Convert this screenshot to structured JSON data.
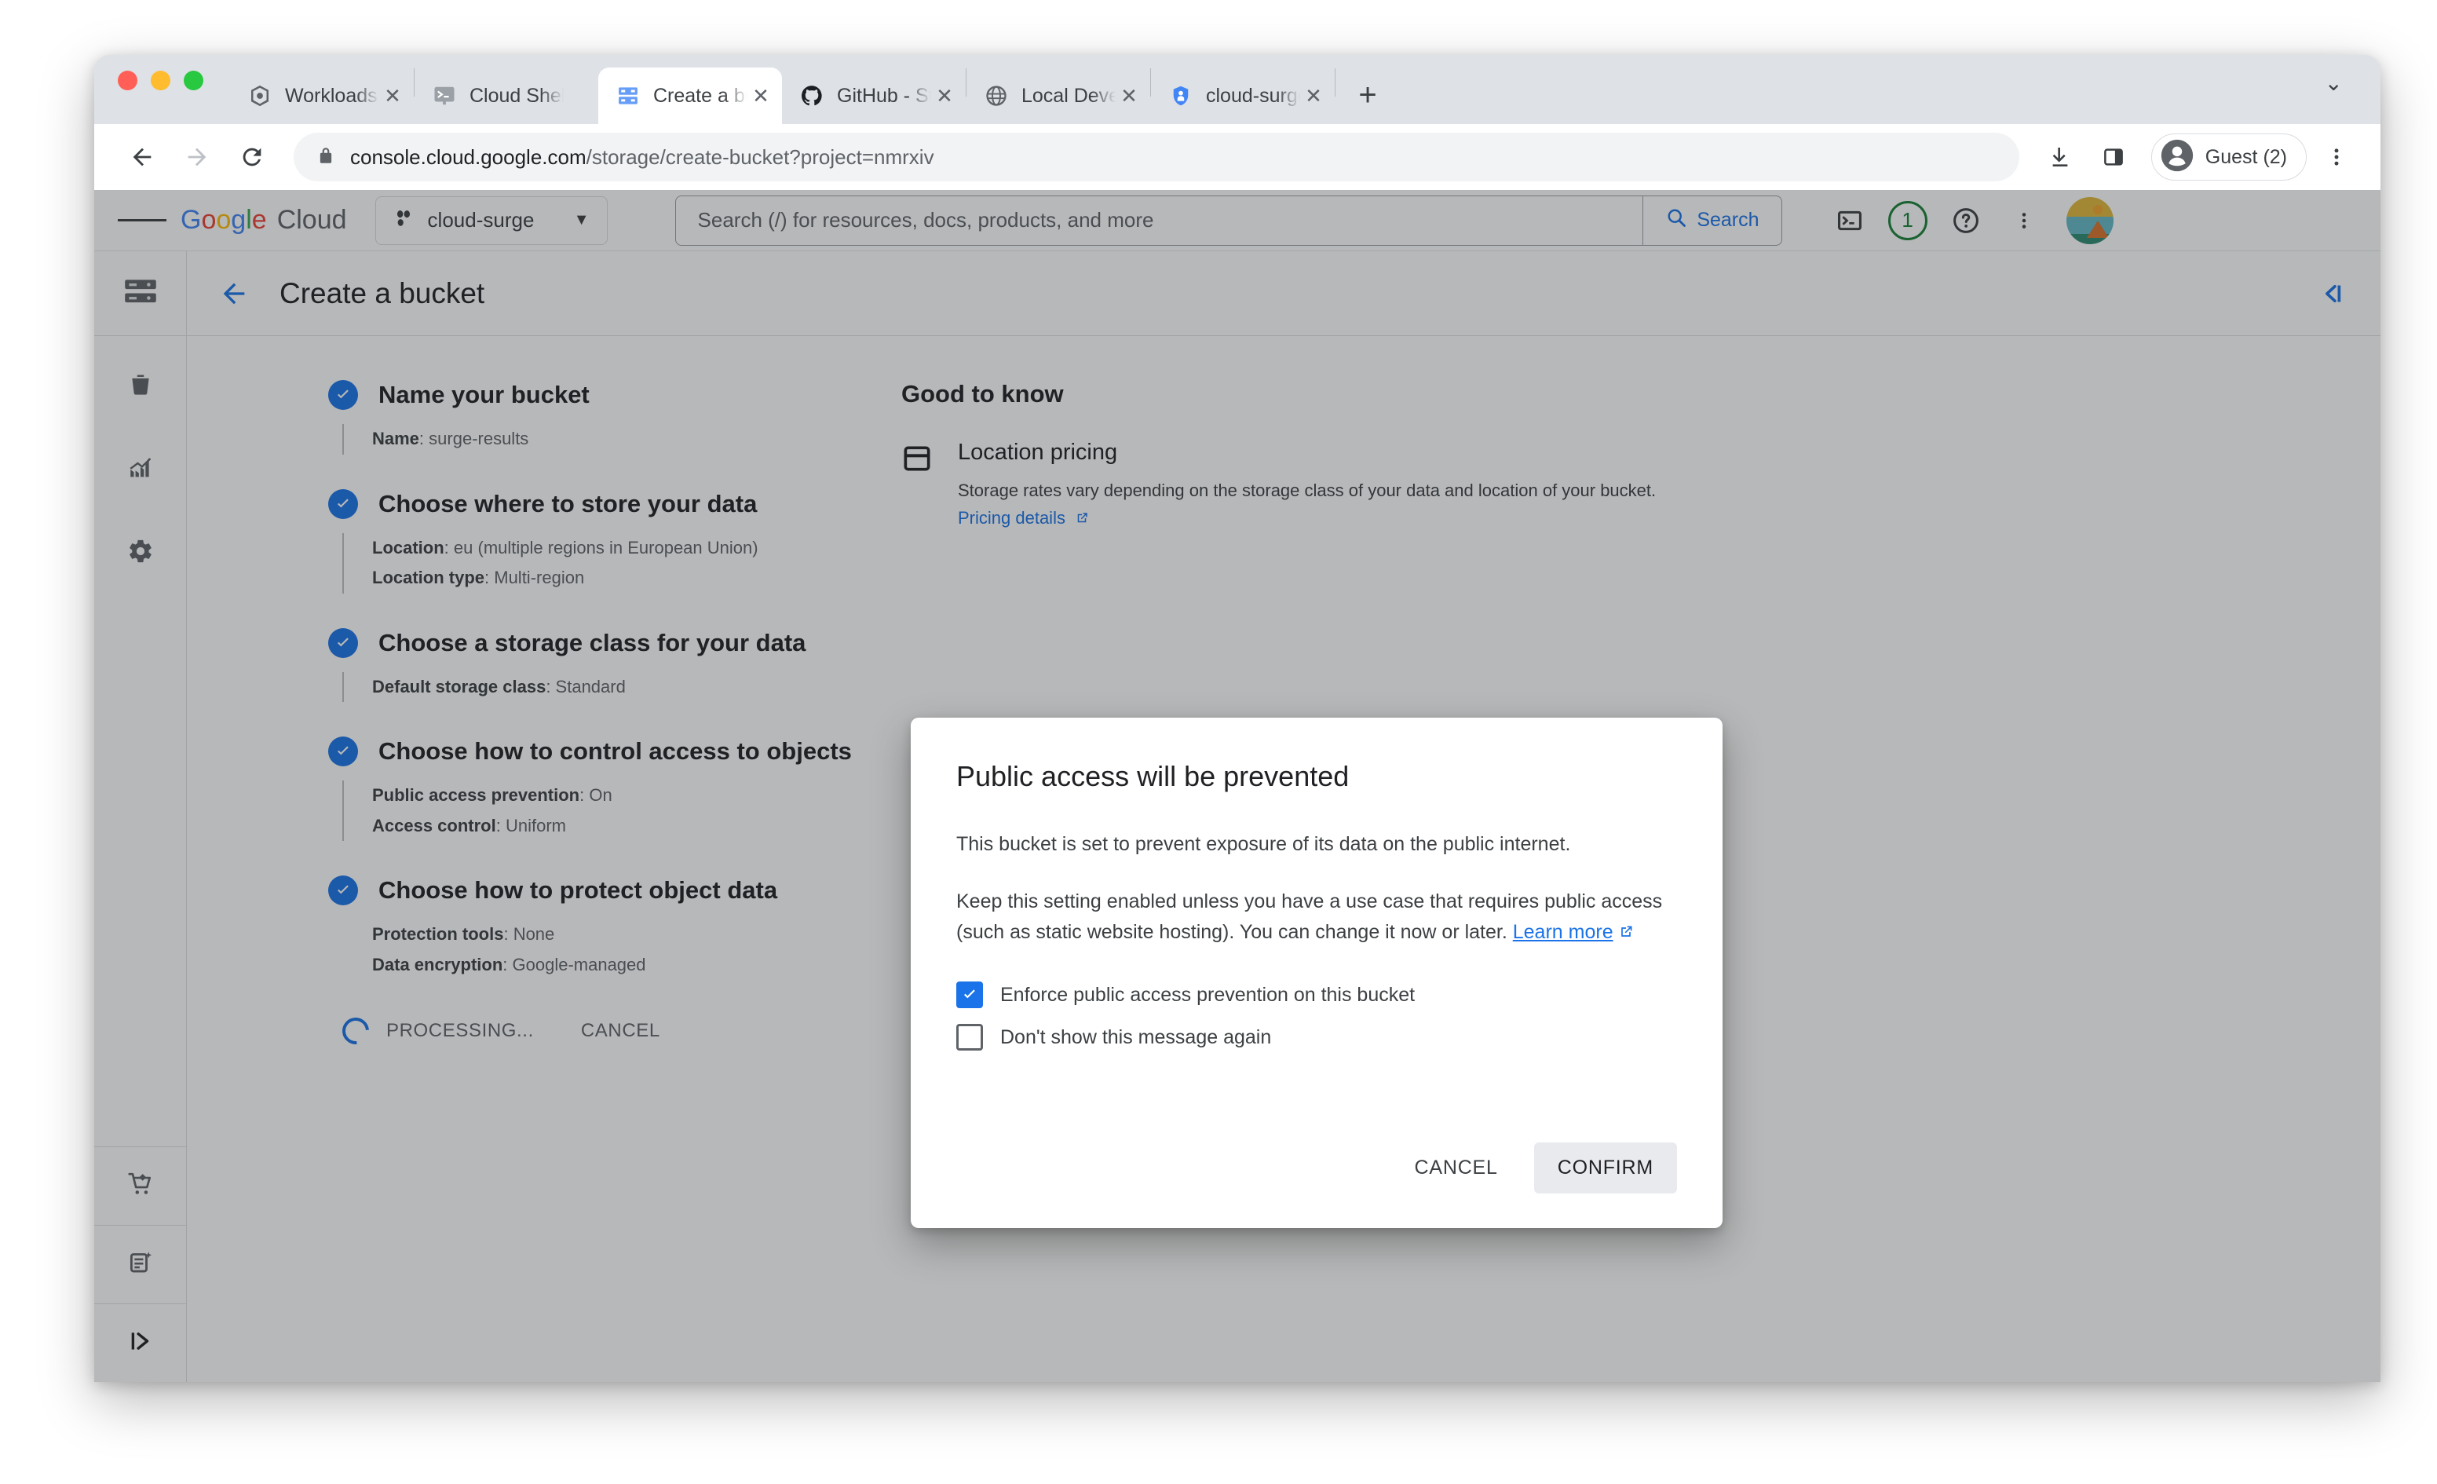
{
  "browser": {
    "tabs": [
      {
        "title": "Workloads – Kubernetes",
        "favicon": "kubernetes-icon",
        "active": false
      },
      {
        "title": "Cloud Shell",
        "favicon": "cloud-shell-icon",
        "active": false
      },
      {
        "title": "Create a bucket – Cloud",
        "favicon": "cloud-storage-icon",
        "active": true
      },
      {
        "title": "GitHub - Steinbeck-Lab",
        "favicon": "github-icon",
        "active": false
      },
      {
        "title": "Local Development (min",
        "favicon": "globe-icon",
        "active": false
      },
      {
        "title": "cloud-surge-sa – IAM &",
        "favicon": "iam-shield-icon",
        "active": false
      }
    ],
    "new_tab_label": "+",
    "tab_list_chevron": "⌄",
    "toolbar": {
      "back_label": "←",
      "forward_label": "→",
      "reload_label": "⟳",
      "url_secure": "console.cloud.google.com",
      "url_path": "/storage/create-bucket?project=nmrxiv",
      "profile_label": "Guest (2)"
    }
  },
  "gc_header": {
    "logo_google": [
      "G",
      "o",
      "o",
      "g",
      "l",
      "e"
    ],
    "logo_cloud": "Cloud",
    "project_name": "cloud-surge",
    "project_caret": "▼",
    "search_placeholder": "Search (/) for resources, docs, products, and more",
    "search_button_label": "Search",
    "notification_count": "1"
  },
  "page": {
    "title": "Create a bucket",
    "back_icon": "arrow-left-icon",
    "collapse_icon": "collapse-panel-icon"
  },
  "steps": [
    {
      "title": "Name your bucket",
      "details": [
        {
          "label": "Name",
          "value": "surge-results"
        }
      ]
    },
    {
      "title": "Choose where to store your data",
      "details": [
        {
          "label": "Location",
          "value": "eu (multiple regions in European Union)"
        },
        {
          "label": "Location type",
          "value": "Multi-region"
        }
      ]
    },
    {
      "title": "Choose a storage class for your data",
      "details": [
        {
          "label": "Default storage class",
          "value": "Standard"
        }
      ]
    },
    {
      "title": "Choose how to control access to objects",
      "details": [
        {
          "label": "Public access prevention",
          "value": "On"
        },
        {
          "label": "Access control",
          "value": "Uniform"
        }
      ]
    },
    {
      "title": "Choose how to protect object data",
      "details": [
        {
          "label": "Protection tools",
          "value": "None"
        },
        {
          "label": "Data encryption",
          "value": "Google-managed"
        }
      ]
    }
  ],
  "actions": {
    "processing_label": "PROCESSING...",
    "cancel_label": "CANCEL"
  },
  "good_to_know": {
    "heading": "Good to know",
    "item_title": "Location pricing",
    "item_text_line1": "Storage rates vary depending on the storage class of your data and location",
    "item_text_line2": "of your bucket.",
    "item_link": "Pricing details"
  },
  "dialog": {
    "title": "Public access will be prevented",
    "paragraph1": "This bucket is set to prevent exposure of its data on the public internet.",
    "paragraph2_before_link": "Keep this setting enabled unless you have a use case that requires public access (such as static website hosting). You can change it now or later. ",
    "link_label": "Learn more",
    "checkbox_enforce_label": "Enforce public access prevention on this bucket",
    "checkbox_enforce_checked": true,
    "checkbox_dontshow_label": "Don't show this message again",
    "checkbox_dontshow_checked": false,
    "cancel_label": "CANCEL",
    "confirm_label": "CONFIRM"
  },
  "rail": {
    "top_icon": "cloud-storage-icon",
    "items": [
      "bucket-icon",
      "monitoring-chart-icon",
      "settings-gear-icon"
    ],
    "bottom_items": [
      "marketplace-cart-icon",
      "release-notes-icon",
      "expand-rail-icon"
    ]
  },
  "colors": {
    "accent_blue": "#1a73e8",
    "tab_strip": "#dee1e6",
    "scrim": "rgba(32,33,36,0.32)",
    "green": "#188038"
  }
}
